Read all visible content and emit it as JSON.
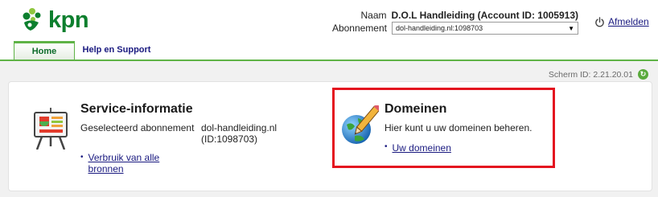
{
  "brand": {
    "name": "kpn",
    "color": "#0d7f2e"
  },
  "account": {
    "name_label": "Naam",
    "name_value": "D.O.L Handleiding (Account ID: 1005913)",
    "subscription_label": "Abonnement",
    "subscription_selected": "dol-handleiding.nl:1098703"
  },
  "logout": {
    "label": "Afmelden",
    "icon": "power-icon"
  },
  "tabs": [
    {
      "label": "Home",
      "active": true
    },
    {
      "label": "Help en Support",
      "active": false
    }
  ],
  "screen_id": {
    "label": "Scherm ID:",
    "value": "2.21.20.01",
    "icon": "refresh-icon"
  },
  "service": {
    "title": "Service-informatie",
    "selected_label": "Geselecteerd abonnement",
    "selected_value": "dol-handleiding.nl (ID:1098703)",
    "link": "Verbruik van alle bronnen",
    "icon": "presentation-board-icon"
  },
  "domains": {
    "title": "Domeinen",
    "description": "Hier kunt u uw domeinen beheren.",
    "link": "Uw domeinen",
    "icon": "globe-pencil-icon"
  },
  "colors": {
    "accent": "#5fb346",
    "highlight": "#e4131f",
    "link": "#1a1a80"
  }
}
